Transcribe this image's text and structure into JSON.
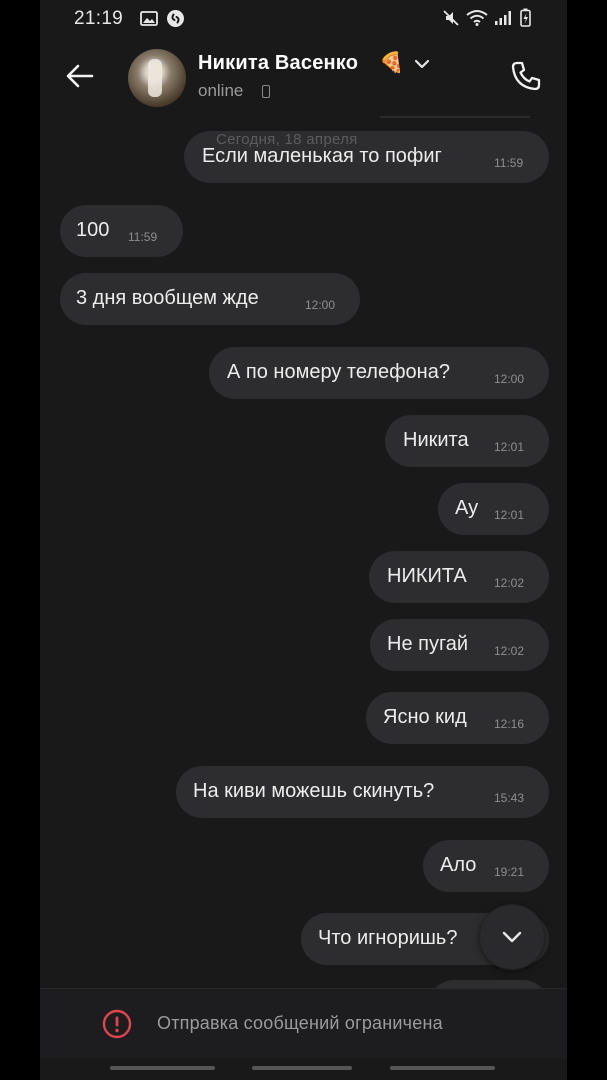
{
  "status_bar": {
    "time": "21:19",
    "left_icons": [
      "gallery-icon",
      "shazam-icon"
    ],
    "right_icons": [
      "mute-icon",
      "wifi-icon",
      "signal-icon",
      "battery-icon"
    ]
  },
  "header": {
    "back_icon": "arrow-left-icon",
    "contact_name": "Никита Васенко",
    "name_emoji": "🍕",
    "status": "online",
    "call_icon": "phone-icon"
  },
  "date_separator": "Сегодня, 18 апреля",
  "messages": [
    {
      "text": "Если маленькая то пофиг",
      "time": "11:59",
      "outgoing": true
    },
    {
      "text": "100",
      "time": "11:59",
      "outgoing": false
    },
    {
      "text": "3 дня вообщем жде",
      "time": "12:00",
      "outgoing": false
    },
    {
      "text": "А по номеру телефона?",
      "time": "12:00",
      "outgoing": true
    },
    {
      "text": "Никита",
      "time": "12:01",
      "outgoing": true
    },
    {
      "text": "Ау",
      "time": "12:01",
      "outgoing": true
    },
    {
      "text": "НИКИТА",
      "time": "12:02",
      "outgoing": true
    },
    {
      "text": "Не пугай",
      "time": "12:02",
      "outgoing": true
    },
    {
      "text": "Ясно кид",
      "time": "12:16",
      "outgoing": true
    },
    {
      "text": "На киви можешь скинуть?",
      "time": "15:43",
      "outgoing": true
    },
    {
      "text": "Ало",
      "time": "19:21",
      "outgoing": true
    },
    {
      "text": "Что игноришь?",
      "time": "",
      "outgoing": true
    }
  ],
  "scroll_down_icon": "chevron-down-icon",
  "bottom_bar": {
    "icon": "warning-circle-icon",
    "text": "Отправка сообщений ограничена",
    "accent_color": "#e0454b"
  },
  "colors": {
    "background": "#19191a",
    "bubble": "#2d2d2f",
    "text": "#ececec",
    "muted": "#8e8e90"
  }
}
